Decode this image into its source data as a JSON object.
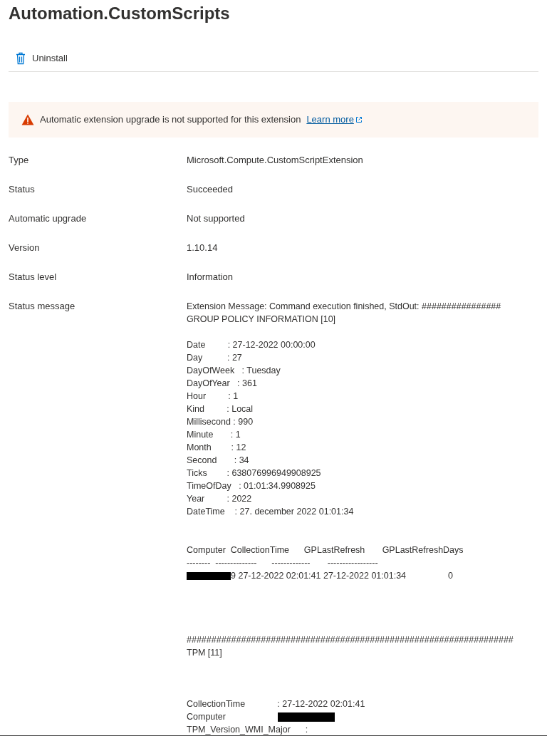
{
  "title": "Automation.CustomScripts",
  "toolbar": [
    {
      "label": "Uninstall"
    }
  ],
  "banner": {
    "message": "Automatic extension upgrade is not supported for this extension",
    "link": "Learn more"
  },
  "properties": [
    {
      "label": "Type",
      "value": "Microsoft.Compute.CustomScriptExtension"
    },
    {
      "label": "Status",
      "value": "Succeeded"
    },
    {
      "label": "Automatic upgrade",
      "value": "Not supported"
    },
    {
      "label": "Version",
      "value": "1.10.14"
    },
    {
      "label": "Status level",
      "value": "Information"
    },
    {
      "label": "Status message",
      "lines": [
        {
          "kind": "text",
          "text": "Extension Message: Command execution finished, StdOut: ################"
        },
        {
          "kind": "text",
          "text": "GROUP POLICY INFORMATION [10]"
        },
        {
          "kind": "blank"
        },
        {
          "kind": "text",
          "text": "Date         : 27-12-2022 00:00:00"
        },
        {
          "kind": "text",
          "text": "Day          : 27"
        },
        {
          "kind": "text",
          "text": "DayOfWeek   : Tuesday"
        },
        {
          "kind": "text",
          "text": "DayOfYear   : 361"
        },
        {
          "kind": "text",
          "text": "Hour         : 1"
        },
        {
          "kind": "text",
          "text": "Kind         : Local"
        },
        {
          "kind": "text",
          "text": "Millisecond : 990"
        },
        {
          "kind": "text",
          "text": "Minute       : 1"
        },
        {
          "kind": "text",
          "text": "Month        : 12"
        },
        {
          "kind": "text",
          "text": "Second       : 34"
        },
        {
          "kind": "text",
          "text": "Ticks        : 638076996949908925"
        },
        {
          "kind": "text",
          "text": "TimeOfDay   : 01:01:34.9908925"
        },
        {
          "kind": "text",
          "text": "Year         : 2022"
        },
        {
          "kind": "text",
          "text": "DateTime    : 27. december 2022 01:01:34"
        },
        {
          "kind": "blank"
        },
        {
          "kind": "blank"
        },
        {
          "kind": "text",
          "text": "Computer  CollectionTime      GPLastRefresh       GPLastRefreshDays"
        },
        {
          "kind": "text",
          "text": "--------  --------------      -------------       -----------------"
        },
        {
          "kind": "redacted_prefix",
          "text": "9 27-12-2022 02:01:41 27-12-2022 01:01:34                 0"
        },
        {
          "kind": "blank"
        },
        {
          "kind": "blank"
        },
        {
          "kind": "blank"
        },
        {
          "kind": "blank"
        },
        {
          "kind": "text",
          "text": "##################################################################"
        },
        {
          "kind": "text",
          "text": "TPM [11]"
        },
        {
          "kind": "blank"
        },
        {
          "kind": "blank"
        },
        {
          "kind": "blank"
        },
        {
          "kind": "text",
          "text": "CollectionTime             : 27-12-2022 02:01:41"
        },
        {
          "kind": "redacted_value",
          "text": "Computer"
        },
        {
          "kind": "text",
          "text": "TPM_Version_WMI_Major      :"
        }
      ]
    }
  ]
}
